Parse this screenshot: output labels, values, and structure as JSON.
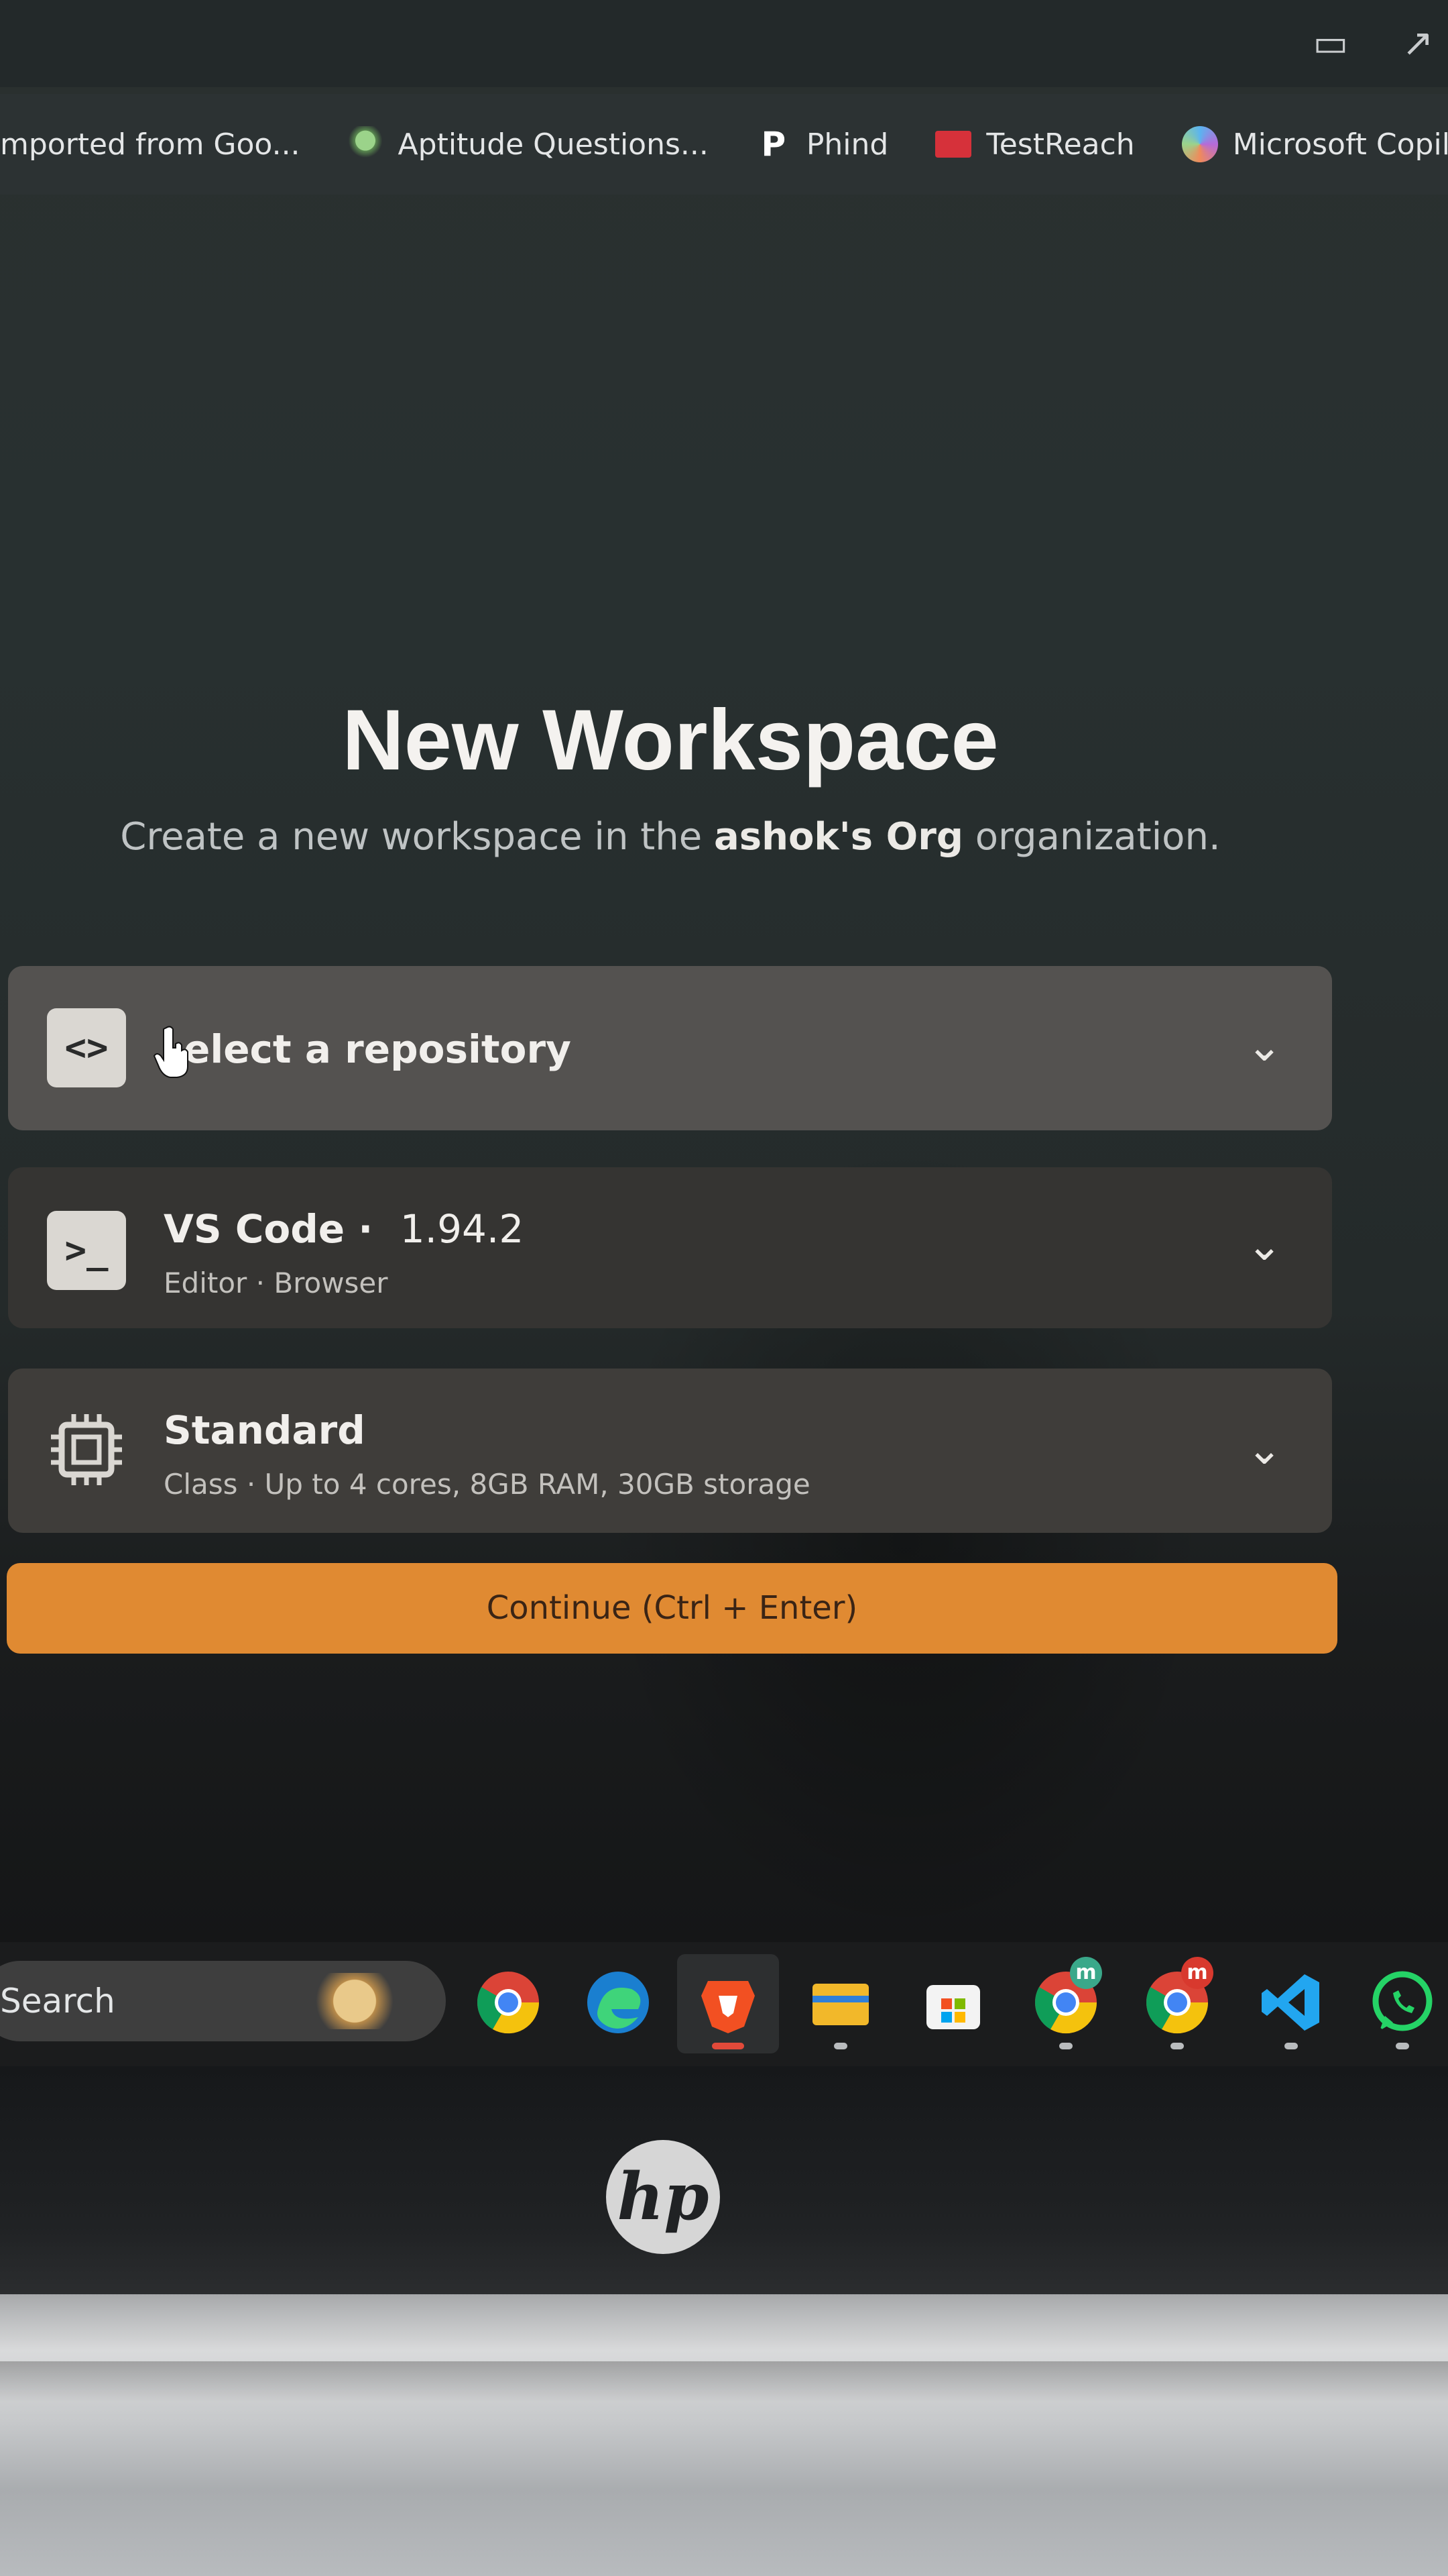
{
  "browser": {
    "bookmarks": [
      {
        "label": "mported from Goo...",
        "icon": "folder-icon"
      },
      {
        "label": "Aptitude Questions...",
        "icon": "mushroom-icon"
      },
      {
        "label": "Phind",
        "icon": "phind-icon"
      },
      {
        "label": "TestReach",
        "icon": "testreach-icon"
      },
      {
        "label": "Microsoft Copilot",
        "icon": "copilot-icon"
      }
    ]
  },
  "page": {
    "title": "New Workspace",
    "subtitle_prefix": "Create a new workspace in the ",
    "org_name": "ashok's Org",
    "subtitle_suffix": " organization."
  },
  "repo_select": {
    "label": "elect a repository",
    "icon": "code-icon"
  },
  "editor_select": {
    "name": "VS Code ·",
    "version": "1.94.2",
    "detail": "Editor · Browser",
    "icon": "terminal-icon"
  },
  "class_select": {
    "name": "Standard",
    "detail": "Class · Up to 4 cores, 8GB RAM, 30GB storage",
    "icon": "cpu-icon"
  },
  "continue_button": {
    "label": "Continue (Ctrl + Enter)"
  },
  "taskbar": {
    "search_label": "Search",
    "apps": [
      "chrome",
      "edge",
      "brave",
      "file-explorer",
      "microsoft-store",
      "chrome-profile-1",
      "chrome-profile-2",
      "vscode",
      "whatsapp"
    ],
    "badges": [
      "m",
      "m"
    ]
  },
  "device": {
    "brand": "hp"
  },
  "colors": {
    "accent": "#e08a32",
    "background": "#262c2c"
  }
}
